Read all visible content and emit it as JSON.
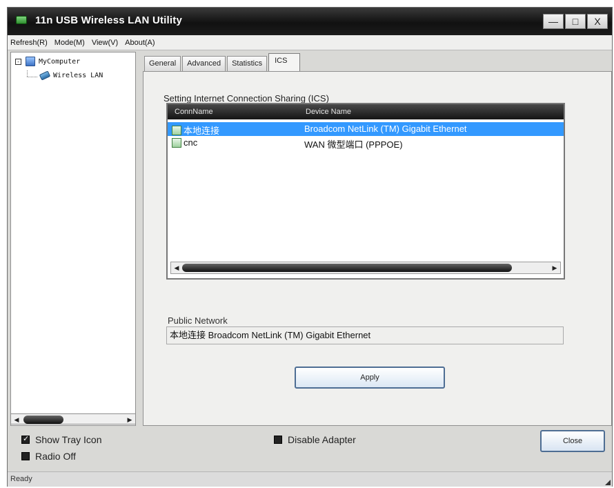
{
  "window": {
    "title": "11n USB Wireless LAN Utility",
    "controls": {
      "minimize": "—",
      "maximize": "□",
      "close": "X"
    }
  },
  "menu": {
    "items": [
      {
        "label": "Refresh(R)"
      },
      {
        "label": "Mode(M)"
      },
      {
        "label": "View(V)"
      },
      {
        "label": "About(A)"
      }
    ]
  },
  "tree": {
    "root": {
      "toggle": "-",
      "label": "MyComputer"
    },
    "child": {
      "label": "Wireless LAN"
    }
  },
  "tabs": [
    {
      "label": "General",
      "active": false
    },
    {
      "label": "Advanced",
      "active": false
    },
    {
      "label": "Statistics",
      "active": false
    },
    {
      "label": "ICS",
      "active": true
    }
  ],
  "ics": {
    "section_title": "Setting Internet Connection Sharing (ICS)",
    "columns": {
      "conn_name": "ConnName",
      "device_name": "Device Name"
    },
    "rows": [
      {
        "conn_name": "本地连接",
        "device_name": "Broadcom NetLink (TM) Gigabit Ethernet",
        "selected": true
      },
      {
        "conn_name": "cnc",
        "device_name": "WAN 微型端口 (PPPOE)",
        "selected": false
      }
    ],
    "public_network_label": "Public Network",
    "public_network_value": "本地连接 Broadcom NetLink (TM) Gigabit Ethernet",
    "apply_label": "Apply"
  },
  "options": {
    "show_tray_icon": {
      "label": "Show Tray Icon",
      "checked": true
    },
    "radio_off": {
      "label": "Radio Off",
      "checked": false
    },
    "disable_adapter": {
      "label": "Disable Adapter",
      "checked": false
    },
    "close_label": "Close"
  },
  "status": {
    "text": "Ready"
  },
  "colors": {
    "selection": "#3399ff",
    "title_bar": "#111111",
    "button_border": "#4d6d93"
  }
}
